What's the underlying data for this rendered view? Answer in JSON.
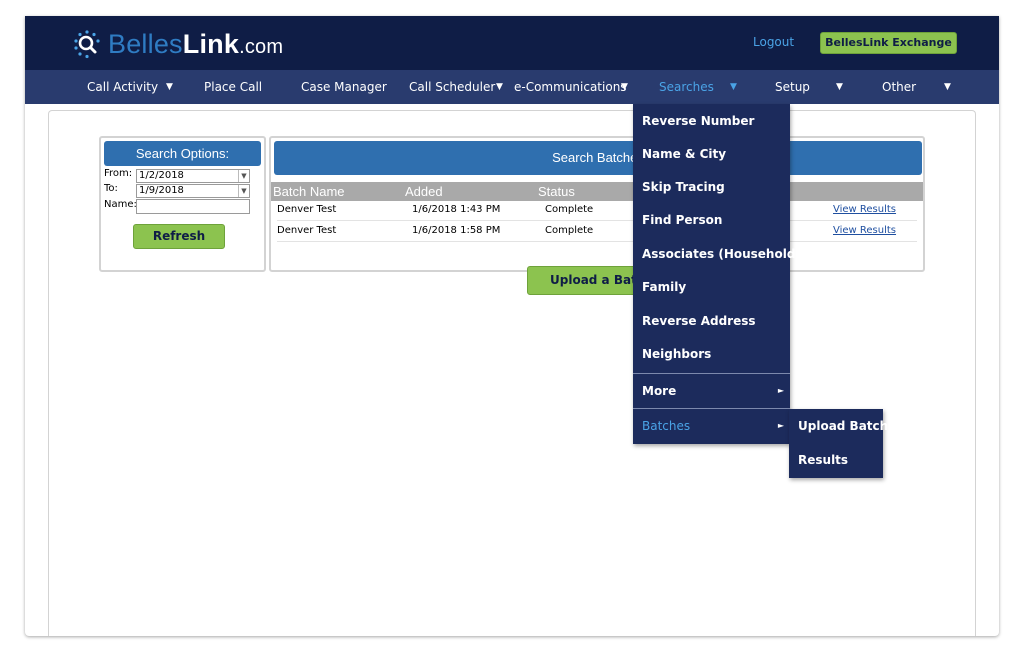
{
  "header": {
    "logo": {
      "part1": "Belles",
      "part2": "Link",
      "part3": ".com"
    },
    "logout_label": "Logout",
    "exchange_label": "BellesLink Exchange"
  },
  "nav": {
    "items": [
      {
        "label": "Call Activity",
        "has_caret": true
      },
      {
        "label": "Place Call",
        "has_caret": false
      },
      {
        "label": "Case Manager",
        "has_caret": false
      },
      {
        "label": "Call Scheduler",
        "has_caret": true
      },
      {
        "label": "e-Communications",
        "has_caret": true
      },
      {
        "label": "Searches",
        "has_caret": true,
        "active": true
      },
      {
        "label": "Setup",
        "has_caret": true
      },
      {
        "label": "Other",
        "has_caret": true
      }
    ],
    "caret": "▼"
  },
  "search_options": {
    "title": "Search Options:",
    "from_label": "From:",
    "from_value": "1/2/2018",
    "to_label": "To:",
    "to_value": "1/9/2018",
    "name_label": "Name:",
    "name_value": "",
    "refresh_label": "Refresh"
  },
  "batches": {
    "title": "Search Batches",
    "columns": [
      "Batch Name",
      "Added",
      "Status"
    ],
    "rows": [
      {
        "name": "Denver Test",
        "added": "1/6/2018 1:43 PM",
        "status": "Complete",
        "link": "View Results"
      },
      {
        "name": "Denver Test",
        "added": "1/6/2018 1:58 PM",
        "status": "Complete",
        "link": "View Results"
      }
    ],
    "upload_label": "Upload a Batch"
  },
  "searches_menu": {
    "items": [
      "Reverse Number",
      "Name & City",
      "Skip Tracing",
      "Find Person",
      "Associates (Household)",
      "Family",
      "Reverse Address",
      "Neighbors"
    ],
    "more_label": "More",
    "batches_label": "Batches",
    "arrow": "►"
  },
  "batches_submenu": {
    "items": [
      "Upload Batch",
      "Results"
    ]
  },
  "colors": {
    "header_bg": "#0f1d46",
    "nav_bg": "#293b6e",
    "accent_blue": "#4aa3e6",
    "button_green": "#8cc34f",
    "panel_blue": "#2f6faf"
  }
}
